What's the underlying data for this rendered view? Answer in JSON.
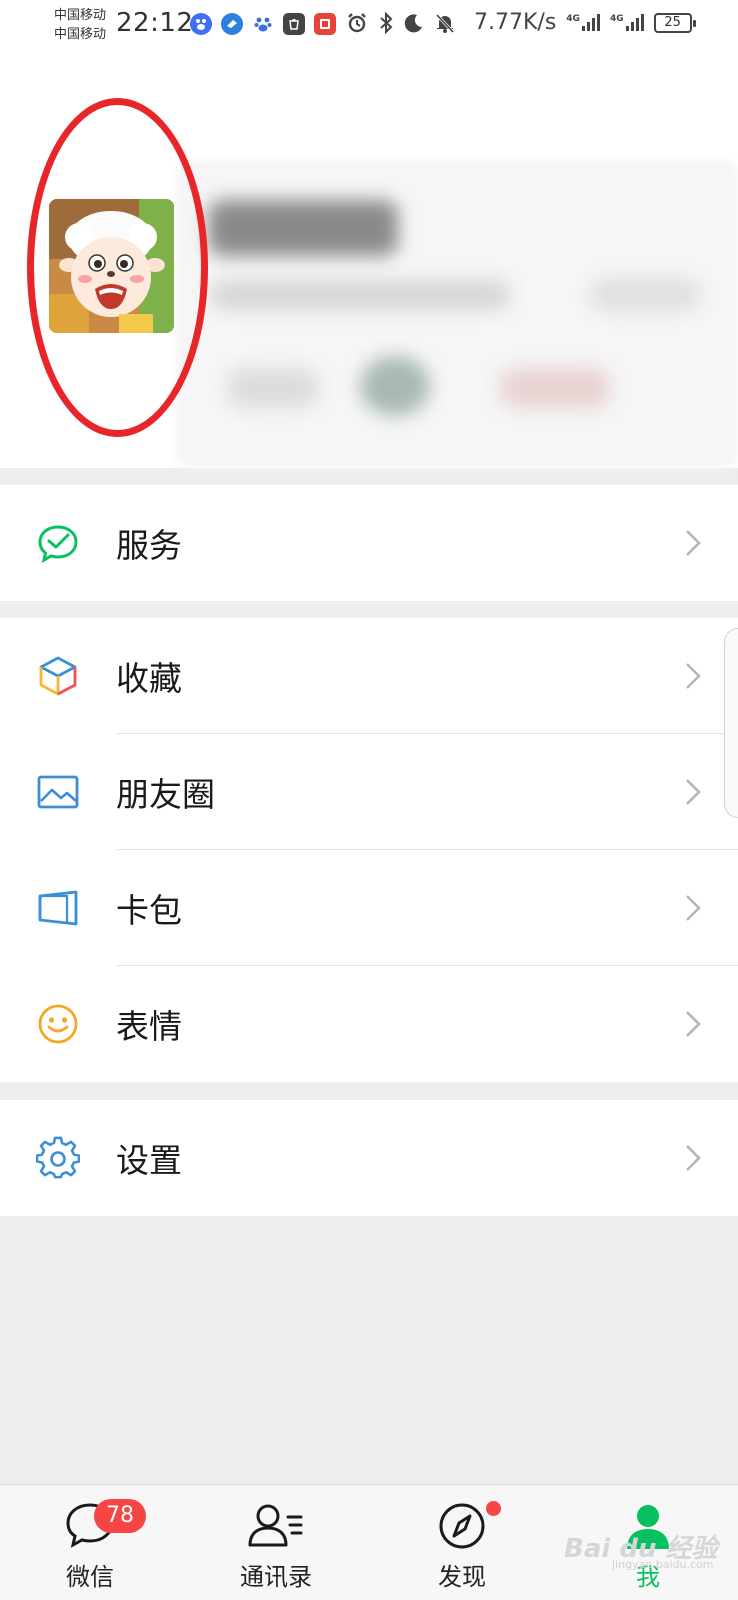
{
  "status_bar": {
    "carrier_1": "中国移动",
    "carrier_2": "中国移动",
    "time": "22:12",
    "app_icons": [
      "baidu-icon",
      "bird-icon",
      "baidu-paw-icon",
      "huawei-store-icon",
      "book-icon"
    ],
    "net_speed": "7.77K/s",
    "sim_1_network": "4G",
    "sim_2_network": "4G",
    "battery": "25"
  },
  "profile": {
    "avatar": "pleasant-goat-avatar",
    "name_blurred": true,
    "highlight_color": "#e8262a"
  },
  "menu": {
    "services": {
      "label": "服务",
      "icon": "services-icon",
      "color": "#07c160"
    },
    "favorites": {
      "label": "收藏",
      "icon": "favorites-cube-icon"
    },
    "moments": {
      "label": "朋友圈",
      "icon": "moments-photo-icon",
      "color": "#3b8fd6"
    },
    "cards": {
      "label": "卡包",
      "icon": "card-wallet-icon",
      "color": "#3b8fd6"
    },
    "stickers": {
      "label": "表情",
      "icon": "sticker-smiley-icon",
      "color": "#f5a623"
    },
    "settings": {
      "label": "设置",
      "icon": "settings-gear-icon",
      "color": "#3b8fd6"
    }
  },
  "tabbar": {
    "chats": {
      "label": "微信",
      "badge": "78"
    },
    "contacts": {
      "label": "通讯录"
    },
    "discover": {
      "label": "发现",
      "dot": true
    },
    "me": {
      "label": "我",
      "active": true,
      "color": "#07c160"
    }
  },
  "watermark": {
    "text": "Bai du 经验",
    "sub": "jingyan.baidu.com"
  }
}
